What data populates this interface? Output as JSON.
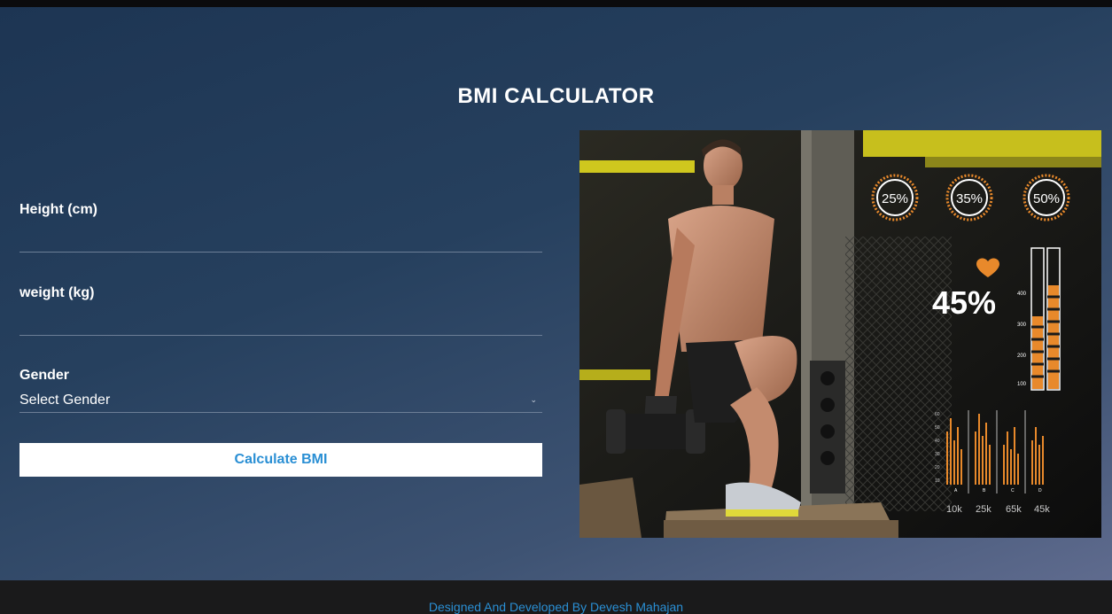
{
  "app": {
    "title": "BMI CALCULATOR"
  },
  "form": {
    "height_label": "Height (cm)",
    "height_value": "",
    "weight_label": "weight (kg)",
    "weight_value": "",
    "gender_label": "Gender",
    "gender_selected": "Select Gender",
    "calculate_label": "Calculate BMI"
  },
  "hero": {
    "rings": [
      "25%",
      "35%",
      "50%"
    ],
    "big_percent": "45%",
    "gauge_ticks": [
      "400",
      "300",
      "200",
      "100"
    ],
    "bar_group_labels": [
      "A",
      "B",
      "C",
      "D"
    ],
    "bar_values": [
      "10k",
      "25k",
      "65k",
      "45k"
    ],
    "mini_axis": [
      "60",
      "50",
      "40",
      "30",
      "20",
      "10"
    ]
  },
  "footer": {
    "credit": "Designed And Developed By Devesh Mahajan"
  },
  "colors": {
    "accent_blue": "#2a8fd4",
    "hud_orange": "#e8892b",
    "gym_yellow": "#cfc71e"
  }
}
